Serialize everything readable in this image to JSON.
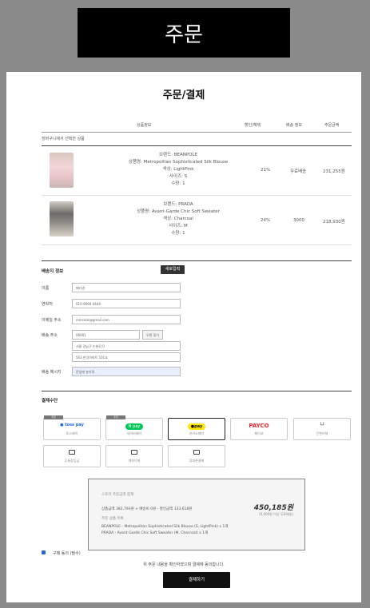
{
  "header": {
    "title": "주문"
  },
  "page": {
    "title": "주문/결제"
  },
  "table": {
    "headers": [
      "상품정보",
      "할인/혜택",
      "배송 정보",
      "주문금액"
    ],
    "cart_label": "장바구니에서 선택한 상품",
    "rows": [
      {
        "brand": "브랜드: BEANPOLE",
        "name": "상품명: Metropolitan Sophisticated Silk Blouse",
        "color": "색상: LightPink",
        "size": "사이즈: S",
        "qty": "수량: 1",
        "discount": "21%",
        "shipping": "무료배송",
        "price": "231,255원"
      },
      {
        "brand": "브랜드: PRADA",
        "name": "상품명: Avant-Garde Chic Soft Sweater",
        "color": "색상: Charcoal",
        "size": "사이즈: M",
        "qty": "수량: 1",
        "discount": "24%",
        "shipping": "3000",
        "price": "218,930원"
      }
    ]
  },
  "shipping_form": {
    "title": "배송지 정보",
    "new_button": "새로입력",
    "fields": {
      "name_label": "이름",
      "name_value": "배다영",
      "phone_label": "연락처",
      "phone_value": "010-9090-4444",
      "email_label": "이메일 주소",
      "email_value": "minseok@gmail.com",
      "addr_label": "배송 주소",
      "zip_value": "06001",
      "zip_button": "우편 찾기",
      "addr1_value": "서울 강남구 논현로 0",
      "addr2_value": "563 한강아파트 101호",
      "memo_label": "배송 메시지",
      "memo_value": "문앞에 놓아줘"
    }
  },
  "payment": {
    "title": "결제수단",
    "methods": [
      {
        "logo": "● toss pay",
        "name": "토스페이",
        "badge": "추천"
      },
      {
        "logo": "N pay",
        "name": "네이버페이",
        "badge": "추천"
      },
      {
        "logo": "●pay",
        "name": "카카오페이",
        "badge": ""
      },
      {
        "logo": "PAYCO",
        "name": "페이코",
        "badge": ""
      },
      {
        "logo": "└┘",
        "name": "간편이체",
        "badge": ""
      },
      {
        "logo": "",
        "name": "무통장입금",
        "badge": ""
      },
      {
        "logo": "",
        "name": "계좌이체",
        "badge": ""
      },
      {
        "logo": "",
        "name": "휴대폰결제",
        "badge": ""
      }
    ],
    "colors": {
      "toss": "#1c64f2",
      "naver": "#03c75a",
      "kakao": "#fee500",
      "payco": "#e3262d"
    }
  },
  "summary": {
    "heading": "스토어 주문금액 합계",
    "breakdown": "상품금액 382,793원  +  배송비 0원  -  할인금액 133,618원",
    "total": "450,185원",
    "note": "(0,000원 이상 무료배송)",
    "list_heading": "주문 상품 목록",
    "items": [
      "BEANPOLE - Metropolitan Sophisticated Silk Blouse (S, LightPink) x 1개",
      "PRADA - Avant-Garde Chic Soft Sweater (M, Charcoal) x 1개"
    ]
  },
  "agree": {
    "label": "구매 동의 (필수)"
  },
  "notice": "위 주문 내용을 확인하였으며 결제에 동의합니다.",
  "pay_button": "결제하기"
}
